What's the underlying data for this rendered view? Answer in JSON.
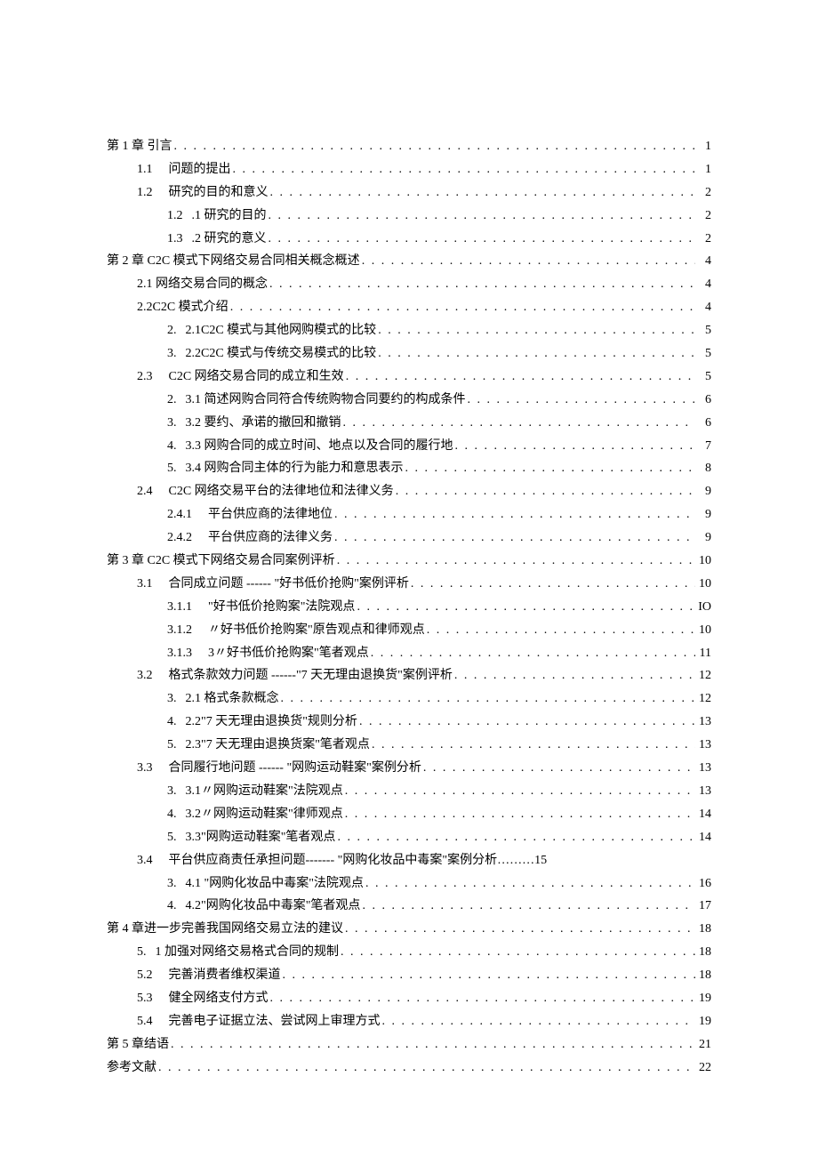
{
  "toc": [
    {
      "level": 0,
      "num": "",
      "title": "第 1 章 引言",
      "page": "1",
      "gap": ""
    },
    {
      "level": 1,
      "num": "1.1",
      "title": "问题的提出",
      "page": "1",
      "gap": "wide"
    },
    {
      "level": 1,
      "num": "1.2",
      "title": "研究的目的和意义",
      "page": "2",
      "gap": "wide"
    },
    {
      "level": 2,
      "num": "1.2",
      "title": ".1 研究的目的",
      "page": "2",
      "gap": "mid"
    },
    {
      "level": 2,
      "num": "1.3",
      "title": ".2 研究的意义",
      "page": "2",
      "gap": "mid"
    },
    {
      "level": 0,
      "num": "",
      "title": "第 2 章 C2C 模式下网络交易合同相关概念概述",
      "page": "4",
      "gap": ""
    },
    {
      "level": 1,
      "num": "",
      "title": "2.1 网络交易合同的概念",
      "page": "4",
      "gap": ""
    },
    {
      "level": 1,
      "num": "",
      "title": "2.2C2C 模式介绍",
      "page": "4",
      "gap": ""
    },
    {
      "level": 2,
      "num": "2.",
      "title": "2.1C2C 模式与其他网购模式的比较",
      "page": "5",
      "gap": "mid"
    },
    {
      "level": 2,
      "num": "3.",
      "title": "2.2C2C 模式与传统交易模式的比较",
      "page": "5",
      "gap": "mid"
    },
    {
      "level": 1,
      "num": "2.3",
      "title": "C2C 网络交易合同的成立和生效",
      "page": "5",
      "gap": "wide"
    },
    {
      "level": 2,
      "num": "2.",
      "title": "3.1 简述网购合同符合传统购物合同要约的构成条件",
      "page": "6",
      "gap": "mid"
    },
    {
      "level": 2,
      "num": "3.",
      "title": "3.2 要约、承诺的撤回和撤销",
      "page": "6",
      "gap": "mid"
    },
    {
      "level": 2,
      "num": "4.",
      "title": "3.3 网购合同的成立时间、地点以及合同的履行地",
      "page": "7",
      "gap": "mid"
    },
    {
      "level": 2,
      "num": "5.",
      "title": "3.4 网购合同主体的行为能力和意思表示",
      "page": "8",
      "gap": "mid"
    },
    {
      "level": 1,
      "num": "2.4",
      "title": "C2C 网络交易平台的法律地位和法律义务",
      "page": "9",
      "gap": "wide"
    },
    {
      "level": 2,
      "num": "2.4.1",
      "title": "平台供应商的法律地位",
      "page": "9",
      "gap": "wide"
    },
    {
      "level": 2,
      "num": "2.4.2",
      "title": "平台供应商的法律义务",
      "page": "9",
      "gap": "wide"
    },
    {
      "level": 0,
      "num": "",
      "title": "第 3 章 C2C 模式下网络交易合同案例评析",
      "page": "10",
      "gap": ""
    },
    {
      "level": 1,
      "num": "3.1",
      "title": "合同成立问题 ------ \"好书低价抢购\"案例评析",
      "page": "10",
      "gap": "wide"
    },
    {
      "level": 2,
      "num": "3.1.1",
      "title": "\"好书低价抢购案\"法院观点",
      "page": "IO",
      "gap": "wide"
    },
    {
      "level": 2,
      "num": "3.1.2",
      "title": "〃好书低价抢购案\"原告观点和律师观点",
      "page": "10",
      "gap": "wide"
    },
    {
      "level": 2,
      "num": "3.1.3",
      "title": "3〃好书低价抢购案\"笔者观点",
      "page": "11",
      "gap": "wide"
    },
    {
      "level": 1,
      "num": "3.2",
      "title": "格式条款效力问题 ------\"7 天无理由退换货\"案例评析",
      "page": "12",
      "gap": "wide"
    },
    {
      "level": 2,
      "num": "3.",
      "title": "2.1 格式条款概念",
      "page": "12",
      "gap": "mid"
    },
    {
      "level": 2,
      "num": "4.",
      "title": "2.2\"7 天无理由退换货\"规则分析",
      "page": "13",
      "gap": "mid"
    },
    {
      "level": 2,
      "num": "5.",
      "title": "2.3\"7 天无理由退换货案\"笔者观点",
      "page": "13",
      "gap": "mid"
    },
    {
      "level": 1,
      "num": "3.3",
      "title": "合同履行地问题 ------ \"网购运动鞋案\"案例分析",
      "page": "13",
      "gap": "wide"
    },
    {
      "level": 2,
      "num": "3.",
      "title": "3.1〃网购运动鞋案\"法院观点",
      "page": "13",
      "gap": "mid"
    },
    {
      "level": 2,
      "num": "4.",
      "title": "3.2〃网购运动鞋案\"律师观点",
      "page": "14",
      "gap": "mid"
    },
    {
      "level": 2,
      "num": "5.",
      "title": "3.3\"网购运动鞋案\"笔者观点",
      "page": "14",
      "gap": "mid"
    },
    {
      "level": 1,
      "num": "3.4",
      "title": "平台供应商责任承担问题------- \"网购化妆品中毒案\"案例分析………15",
      "page": "",
      "gap": "wide",
      "nodots": true
    },
    {
      "level": 2,
      "num": "3.",
      "title": "4.1 \"网购化妆品中毒案\"法院观点",
      "page": "16",
      "gap": "mid"
    },
    {
      "level": 2,
      "num": "4.",
      "title": "4.2\"网购化妆品中毒案\"笔者观点",
      "page": "17",
      "gap": "mid"
    },
    {
      "level": 0,
      "num": "",
      "title": "第 4 章进一步完善我国网络交易立法的建议",
      "page": "18",
      "gap": ""
    },
    {
      "level": 1,
      "num": "5.",
      "title": "1 加强对网络交易格式合同的规制",
      "page": "18",
      "gap": "mid"
    },
    {
      "level": 1,
      "num": "5.2",
      "title": "完善消费者维权渠道",
      "page": "18",
      "gap": "wide"
    },
    {
      "level": 1,
      "num": "5.3",
      "title": "健全网络支付方式",
      "page": "19",
      "gap": "wide"
    },
    {
      "level": 1,
      "num": "5.4",
      "title": "完善电子证据立法、尝试网上审理方式",
      "page": "19",
      "gap": "wide"
    },
    {
      "level": 0,
      "num": "",
      "title": "第 5 章结语",
      "page": "21",
      "gap": ""
    },
    {
      "level": 0,
      "num": "",
      "title": "参考文献",
      "page": "22",
      "gap": ""
    }
  ]
}
